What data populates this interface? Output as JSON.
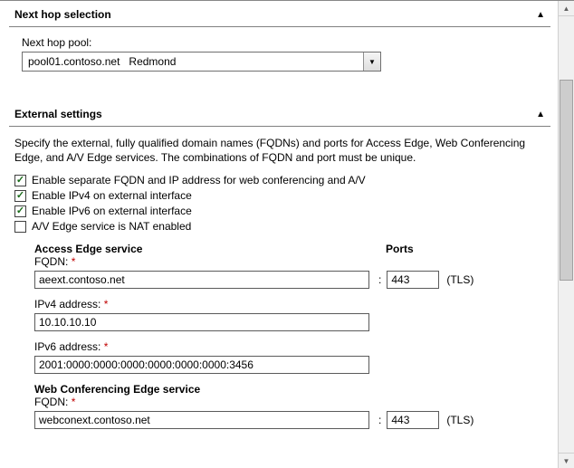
{
  "sections": {
    "next_hop": {
      "title": "Next hop selection",
      "pool_label": "Next hop pool:",
      "pool_value": "pool01.contoso.net   Redmond"
    },
    "external": {
      "title": "External settings",
      "description": "Specify the external, fully qualified domain names (FQDNs) and ports for Access Edge, Web Conferencing Edge, and A/V Edge services. The combinations of FQDN and port must be unique.",
      "checkboxes": {
        "separate_fqdn": {
          "label": "Enable separate FQDN and IP address for web conferencing and A/V",
          "checked": true
        },
        "ipv4": {
          "label": "Enable IPv4 on external interface",
          "checked": true
        },
        "ipv6": {
          "label": "Enable IPv6 on external interface",
          "checked": true
        },
        "nat": {
          "label": "A/V Edge service is NAT enabled",
          "checked": false
        }
      },
      "ports_label": "Ports",
      "access_edge": {
        "title": "Access Edge service",
        "fqdn_label": "FQDN:",
        "fqdn_value": "aeext.contoso.net",
        "port_value": "443",
        "proto": "(TLS)",
        "ipv4_label": "IPv4 address:",
        "ipv4_value": "10.10.10.10",
        "ipv6_label": "IPv6 address:",
        "ipv6_value": "2001:0000:0000:0000:0000:0000:0000:3456"
      },
      "web_conf": {
        "title": "Web Conferencing Edge service",
        "fqdn_label": "FQDN:",
        "fqdn_value": "webconext.contoso.net",
        "port_value": "443",
        "proto": "(TLS)"
      }
    }
  },
  "glyphs": {
    "up_triangle": "▲",
    "down_triangle": "▼",
    "check": "✓",
    "req": "*",
    "colon": ":"
  }
}
